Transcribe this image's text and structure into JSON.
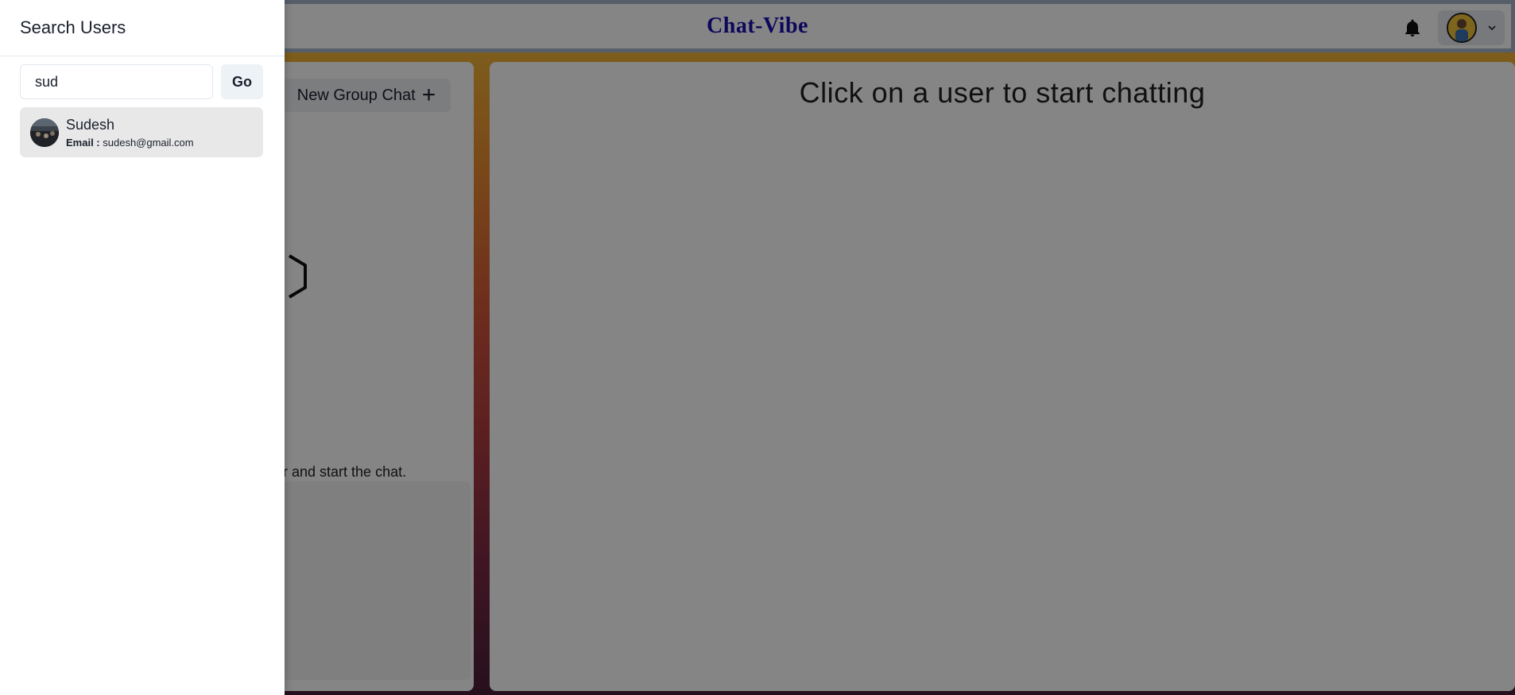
{
  "header": {
    "title": "Chat-Vibe",
    "bell_icon": "bell-icon",
    "avatar_icon": "user-avatar",
    "chevron_icon": "chevron-down-icon"
  },
  "chats": {
    "new_group_label": "New Group Chat",
    "plus_icon": "+",
    "empty_hint": "er and start the chat."
  },
  "chat_area": {
    "placeholder": "Click on a user to start chatting"
  },
  "drawer": {
    "title": "Search Users",
    "search": {
      "value": "sud"
    },
    "go_label": "Go",
    "results": [
      {
        "name": "Sudesh",
        "email_label": "Email :",
        "email": "sudesh@gmail.com"
      }
    ]
  },
  "colors": {
    "title_color": "#1a0fb0",
    "overlay": "rgba(0,0,0,0.48)"
  }
}
